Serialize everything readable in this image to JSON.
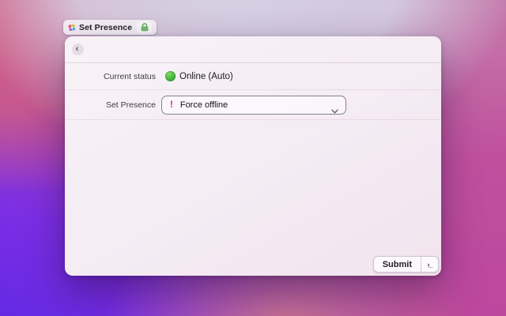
{
  "tab": {
    "title": "Set Presence",
    "app_icon": "flower-icon",
    "permission_icon": "lock-icon"
  },
  "window": {
    "header": {
      "back_glyph": "‹"
    },
    "status_row": {
      "label": "Current status",
      "value": "Online (Auto)",
      "indicator": "online-status-dot",
      "indicator_color": "#3cb23f"
    },
    "presence_row": {
      "label": "Set Presence",
      "selected_option": "Force offline",
      "warning_glyph": "!",
      "warning_color": "#d42b3c"
    },
    "footer": {
      "submit_label": "Submit",
      "run_glyph": "›_"
    }
  },
  "colors": {
    "lock_green": "#6fba6d",
    "window_bg": "#f5ecf4",
    "wallpaper_violet": "#7c2ee4",
    "wallpaper_magenta": "#bf479b",
    "wallpaper_rose": "#d06087",
    "wallpaper_lavender": "#d6d5e6"
  }
}
